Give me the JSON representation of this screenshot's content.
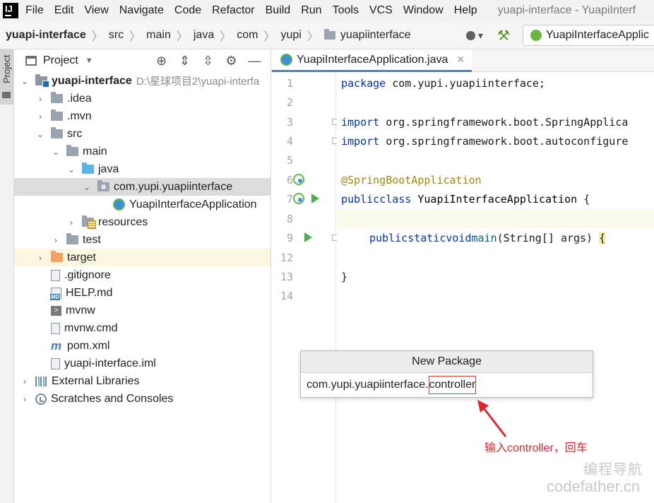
{
  "menu": [
    "File",
    "Edit",
    "View",
    "Navigate",
    "Code",
    "Refactor",
    "Build",
    "Run",
    "Tools",
    "VCS",
    "Window",
    "Help"
  ],
  "window_title": "yuapi-interface - YuapiInterf",
  "breadcrumb": [
    "yuapi-interface",
    "src",
    "main",
    "java",
    "com",
    "yupi",
    "yuapiinterface"
  ],
  "run_config": "YuapiInterfaceApplic",
  "project_panel": {
    "title": "Project"
  },
  "tree": [
    {
      "label": "yuapi-interface",
      "path": "D:\\星球项目2\\yuapi-interfa"
    },
    {
      "label": ".idea"
    },
    {
      "label": ".mvn"
    },
    {
      "label": "src"
    },
    {
      "label": "main"
    },
    {
      "label": "java"
    },
    {
      "label": "com.yupi.yuapiinterface"
    },
    {
      "label": "YuapiInterfaceApplication"
    },
    {
      "label": "resources"
    },
    {
      "label": "test"
    },
    {
      "label": "target"
    },
    {
      "label": ".gitignore"
    },
    {
      "label": "HELP.md"
    },
    {
      "label": "mvnw"
    },
    {
      "label": "mvnw.cmd"
    },
    {
      "label": "pom.xml"
    },
    {
      "label": "yuapi-interface.iml"
    },
    {
      "label": "External Libraries"
    },
    {
      "label": "Scratches and Consoles"
    }
  ],
  "stripe_tab": "Project",
  "editor_tab": "YuapiInterfaceApplication.java",
  "gutter_numbers": [
    "1",
    "2",
    "3",
    "4",
    "5",
    "6",
    "7",
    "8",
    "9",
    "12",
    "13",
    "14"
  ],
  "code": {
    "l1_kw": "package",
    "l1_rest": " com.yupi.yuapiinterface;",
    "l3_kw": "import",
    "l3_rest": " org.springframework.boot.SpringApplica",
    "l4_kw": "import",
    "l4_rest": " org.springframework.boot.autoconfigure",
    "l6_ann": "@SpringBootApplication",
    "l7_kw1": "public",
    "l7_kw2": "class",
    "l7_cls": " YuapiInterfaceApplication ",
    "l7_brace": "{",
    "l9_kw1": "public",
    "l9_kw2": "static",
    "l9_kw3": "void",
    "l9_fn": "main",
    "l9_rest": "(String[] args) ",
    "l9_brace": "{",
    "l13": "}"
  },
  "dialog": {
    "title": "New Package",
    "prefix": "com.yupi.yuapiinterface.",
    "typed": "controller"
  },
  "annotation": "输入controller，回车",
  "watermark": {
    "cn": "编程导航",
    "url": "codefather.cn"
  },
  "colors": {
    "keyword": "#0033b3",
    "annotation": "#9e880d",
    "method": "#00627a",
    "highlight_red": "#e0262b",
    "selection_blue": "#4083c9"
  }
}
